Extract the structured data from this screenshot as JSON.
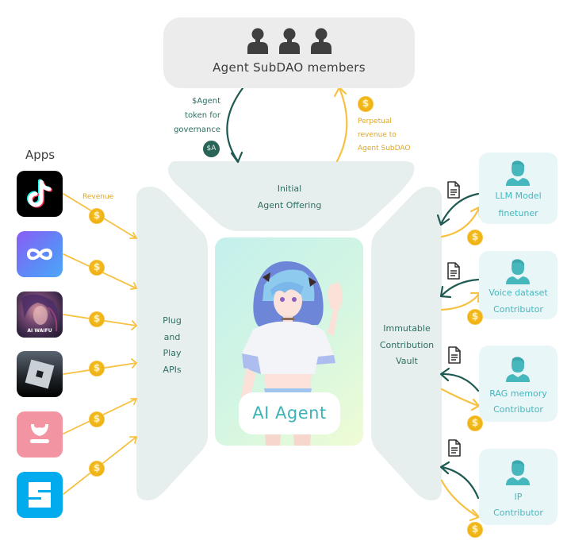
{
  "members": {
    "title": "Agent SubDAO members",
    "icons": [
      "person-icon",
      "person-icon",
      "person-icon"
    ]
  },
  "governance": {
    "label_lines": [
      "$Agent",
      "token for",
      "governance"
    ],
    "token_badge": "$A",
    "arrow_color": "#1f5a52"
  },
  "perpetual_revenue": {
    "label_lines": [
      "Perpetual",
      "revenue to",
      "Agent SubDAO"
    ],
    "arrow_color": "#f7c243"
  },
  "initial_offering": {
    "lines": [
      "Initial",
      "Agent Offering"
    ]
  },
  "apps": {
    "title": "Apps",
    "revenue_label": "Revenue",
    "coin_symbol": "$",
    "items": [
      {
        "name": "TikTok",
        "icon": "tiktok-icon"
      },
      {
        "name": "Infinity",
        "icon": "infinity-icon"
      },
      {
        "name": "AI Waifu",
        "icon": "ai-waifu-icon",
        "caption": "AI WAIFU"
      },
      {
        "name": "Roblox",
        "icon": "roblox-icon"
      },
      {
        "name": "Heart app",
        "icon": "pink-heart-icon"
      },
      {
        "name": "The Sandbox",
        "icon": "sandbox-icon"
      }
    ]
  },
  "plug_and_play": {
    "lines": [
      "Plug",
      "and",
      "Play",
      "APIs"
    ]
  },
  "agent": {
    "label": "AI Agent"
  },
  "vault": {
    "lines": [
      "Immutable",
      "Contribution",
      "Vault"
    ]
  },
  "contributors": [
    {
      "lines": [
        "LLM Model",
        "finetuner"
      ]
    },
    {
      "lines": [
        "Voice dataset",
        "Contributor"
      ]
    },
    {
      "lines": [
        "RAG memory",
        "Contributor"
      ]
    },
    {
      "lines": [
        "IP",
        "Contributor"
      ]
    }
  ],
  "colors": {
    "panel_bg": "#e7efee",
    "teal_text": "#2e6e62",
    "gold": "#f0b316",
    "contributor_text": "#45b7bd",
    "contributor_bg": "#e9f6f7"
  }
}
